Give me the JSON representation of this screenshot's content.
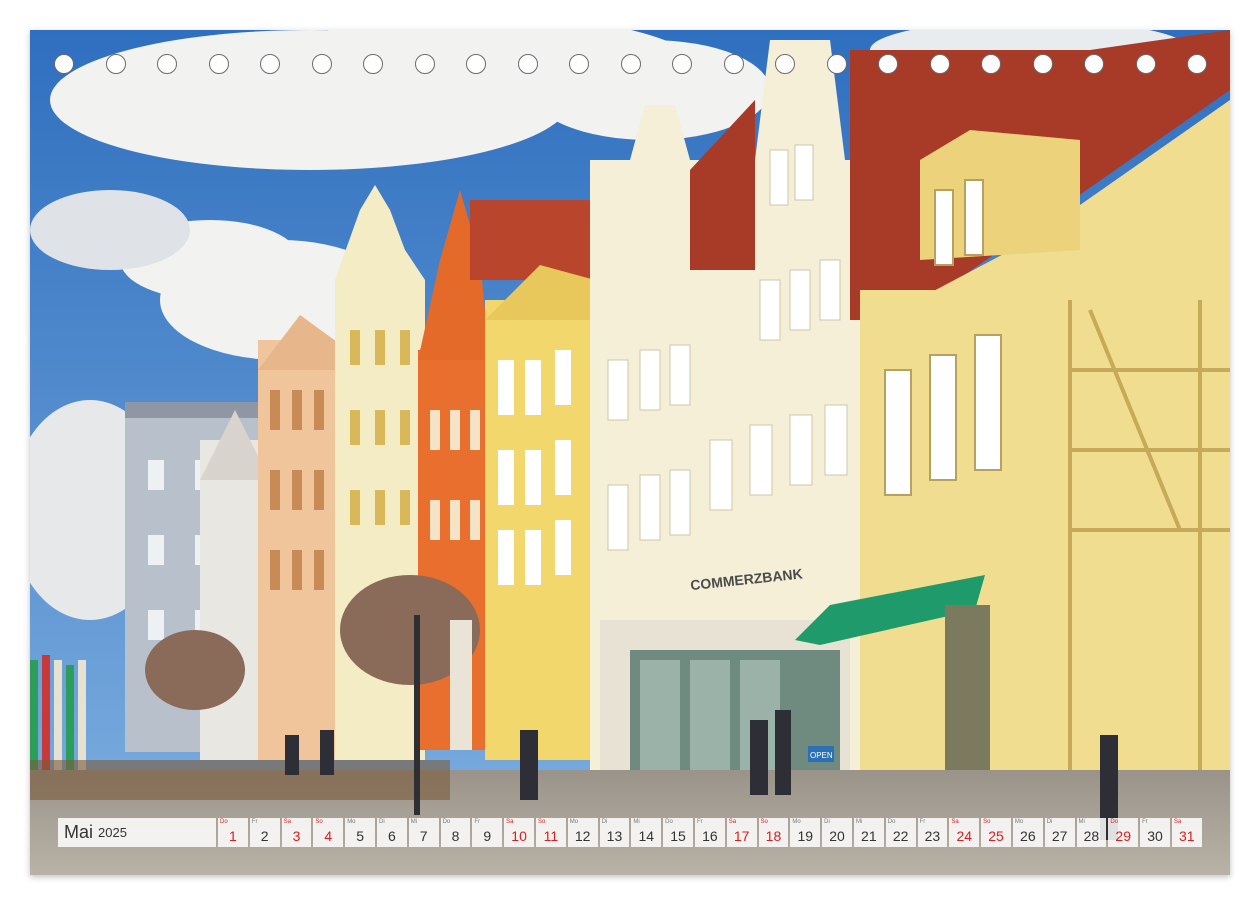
{
  "calendar": {
    "month": "Mai",
    "year": "2025",
    "days": [
      {
        "n": "1",
        "wd": "Do",
        "we": true
      },
      {
        "n": "2",
        "wd": "Fr",
        "we": false
      },
      {
        "n": "3",
        "wd": "Sa",
        "we": true
      },
      {
        "n": "4",
        "wd": "So",
        "we": true
      },
      {
        "n": "5",
        "wd": "Mo",
        "we": false
      },
      {
        "n": "6",
        "wd": "Di",
        "we": false
      },
      {
        "n": "7",
        "wd": "Mi",
        "we": false
      },
      {
        "n": "8",
        "wd": "Do",
        "we": false
      },
      {
        "n": "9",
        "wd": "Fr",
        "we": false
      },
      {
        "n": "10",
        "wd": "Sa",
        "we": true
      },
      {
        "n": "11",
        "wd": "So",
        "we": true
      },
      {
        "n": "12",
        "wd": "Mo",
        "we": false
      },
      {
        "n": "13",
        "wd": "Di",
        "we": false
      },
      {
        "n": "14",
        "wd": "Mi",
        "we": false
      },
      {
        "n": "15",
        "wd": "Do",
        "we": false
      },
      {
        "n": "16",
        "wd": "Fr",
        "we": false
      },
      {
        "n": "17",
        "wd": "Sa",
        "we": true
      },
      {
        "n": "18",
        "wd": "So",
        "we": true
      },
      {
        "n": "19",
        "wd": "Mo",
        "we": false
      },
      {
        "n": "20",
        "wd": "Di",
        "we": false
      },
      {
        "n": "21",
        "wd": "Mi",
        "we": false
      },
      {
        "n": "22",
        "wd": "Do",
        "we": false
      },
      {
        "n": "23",
        "wd": "Fr",
        "we": false
      },
      {
        "n": "24",
        "wd": "Sa",
        "we": true
      },
      {
        "n": "25",
        "wd": "So",
        "we": true
      },
      {
        "n": "26",
        "wd": "Mo",
        "we": false
      },
      {
        "n": "27",
        "wd": "Di",
        "we": false
      },
      {
        "n": "28",
        "wd": "Mi",
        "we": false
      },
      {
        "n": "29",
        "wd": "Do",
        "we": true
      },
      {
        "n": "30",
        "wd": "Fr",
        "we": false
      },
      {
        "n": "31",
        "wd": "Sa",
        "we": true
      }
    ]
  },
  "photo": {
    "bank_sign": "COMMERZBANK",
    "open_sign": "OPEN",
    "colors": {
      "sky": "#3f7fc8",
      "roof": "#a83a28",
      "cream_building": "#f4efd6",
      "yellow_building": "#f1d76c",
      "orange_building": "#e86f2e",
      "awning": "#1f9a6a"
    }
  }
}
